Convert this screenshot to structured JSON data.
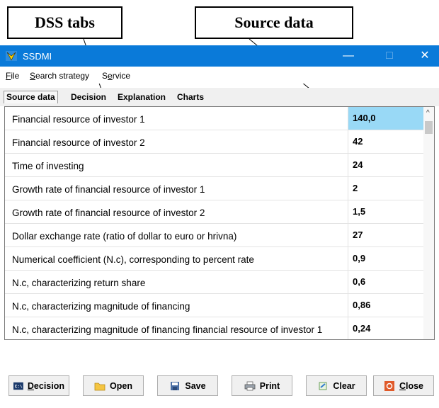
{
  "annotations": {
    "tabs_callout": "DSS tabs",
    "source_callout": "Source data"
  },
  "window": {
    "title": "SSDMI",
    "minimize": "—",
    "maximize": "□",
    "close": "✕"
  },
  "menu": [
    {
      "label": "File",
      "mnemonic": "F",
      "rest": "ile"
    },
    {
      "label": "Search strategy",
      "mnemonic": "S",
      "rest": "earch strategy"
    },
    {
      "label": "Service",
      "mnemonic": "e",
      "pre": "S",
      "rest": "rvice"
    }
  ],
  "tabs": [
    "Source data",
    "Decision",
    "Explanation",
    "Charts"
  ],
  "active_tab": "Source data",
  "rows": [
    {
      "label": "Financial resource of investor 1",
      "value": "140,0"
    },
    {
      "label": "Financial resource of investor 2",
      "value": "42"
    },
    {
      "label": "Time of investing",
      "value": "24"
    },
    {
      "label": "Growth rate of financial resource of investor 1",
      "value": "2"
    },
    {
      "label": "Growth rate of financial resource of investor 2",
      "value": "1,5"
    },
    {
      "label": "Dollar exchange rate (ratio of dollar to euro or hrivna)",
      "value": "27"
    },
    {
      "label": "Numerical coefficient (N.c), corresponding to percent rate",
      "value": "0,9"
    },
    {
      "label": "N.c, characterizing return share",
      "value": "0,6"
    },
    {
      "label": "N.c, characterizing magnitude of financing",
      "value": "0,86"
    },
    {
      "label": "N.c, characterizing magnitude of financing financial resource of investor 1",
      "value": "0,24"
    }
  ],
  "buttons": [
    {
      "name": "decision",
      "label": "Decision",
      "mnemonic": "D",
      "rest": "ecision",
      "icon": "console-icon"
    },
    {
      "name": "open",
      "label": "Open",
      "icon": "folder-icon"
    },
    {
      "name": "save",
      "label": "Save",
      "icon": "save-icon"
    },
    {
      "name": "print",
      "label": "Print",
      "icon": "printer-icon"
    },
    {
      "name": "clear",
      "label": "Clear",
      "icon": "eraser-icon"
    },
    {
      "name": "close",
      "label": "Close",
      "mnemonic": "C",
      "rest": "lose",
      "icon": "close-icon"
    }
  ],
  "colors": {
    "titlebar": "#0a7ad9",
    "selected_cell": "#99d9f6"
  }
}
